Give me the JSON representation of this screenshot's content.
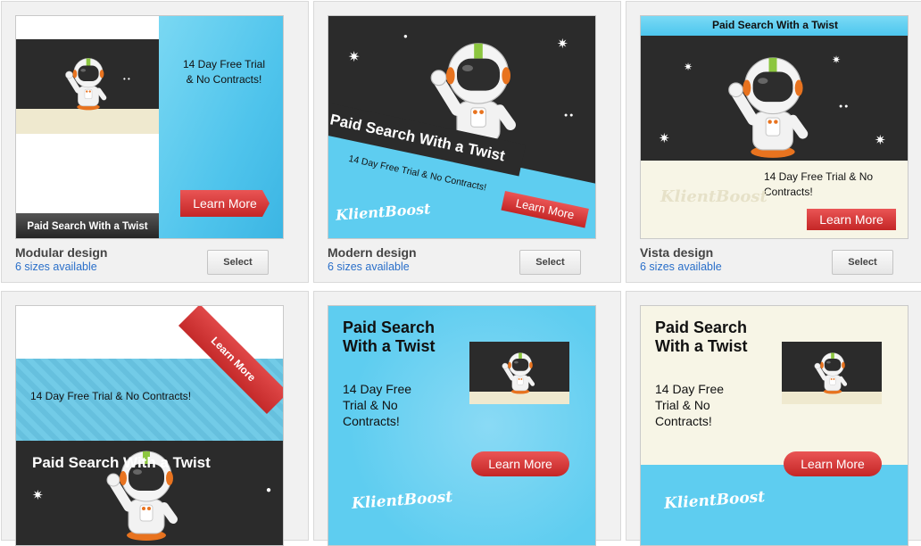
{
  "cards": [
    {
      "name": "Modular design",
      "sizes": "6 sizes available",
      "select": "Select",
      "ad": {
        "trial": "14 Day Free Trial\n& No Contracts!",
        "cta": "Learn More",
        "headline": "Paid Search With a Twist"
      }
    },
    {
      "name": "Modern design",
      "sizes": "6 sizes available",
      "select": "Select",
      "ad": {
        "headline": "Paid Search With a Twist",
        "trial": "14 Day Free Trial & No Contracts!",
        "cta": "Learn More",
        "brand": "KlientBoost"
      }
    },
    {
      "name": "Vista design",
      "sizes": "6 sizes available",
      "select": "Select",
      "ad": {
        "headline": "Paid Search With a Twist",
        "trial": "14 Day Free Trial & No\nContracts!",
        "cta": "Learn More",
        "brand": "KlientBoost"
      }
    },
    {
      "ad": {
        "ribbon": "Learn More",
        "trial": "14 Day Free Trial & No Contracts!",
        "headline": "Paid Search With a Twist"
      }
    },
    {
      "ad": {
        "headline": "Paid Search\nWith a Twist",
        "trial": "14 Day Free\nTrial & No\nContracts!",
        "cta": "Learn More",
        "brand": "KlientBoost"
      }
    },
    {
      "ad": {
        "headline": "Paid Search\nWith a Twist",
        "trial": "14 Day Free\nTrial & No\nContracts!",
        "cta": "Learn More",
        "brand": "KlientBoost"
      }
    }
  ],
  "colors": {
    "sky": "#5ecdf0",
    "dark": "#2b2b2b",
    "cream": "#f7f5e6",
    "red": "#d63535",
    "link": "#2a6fc9"
  },
  "icons": [
    "astronaut-illustration",
    "sparkle-star-icon",
    "ribbon-banner"
  ]
}
